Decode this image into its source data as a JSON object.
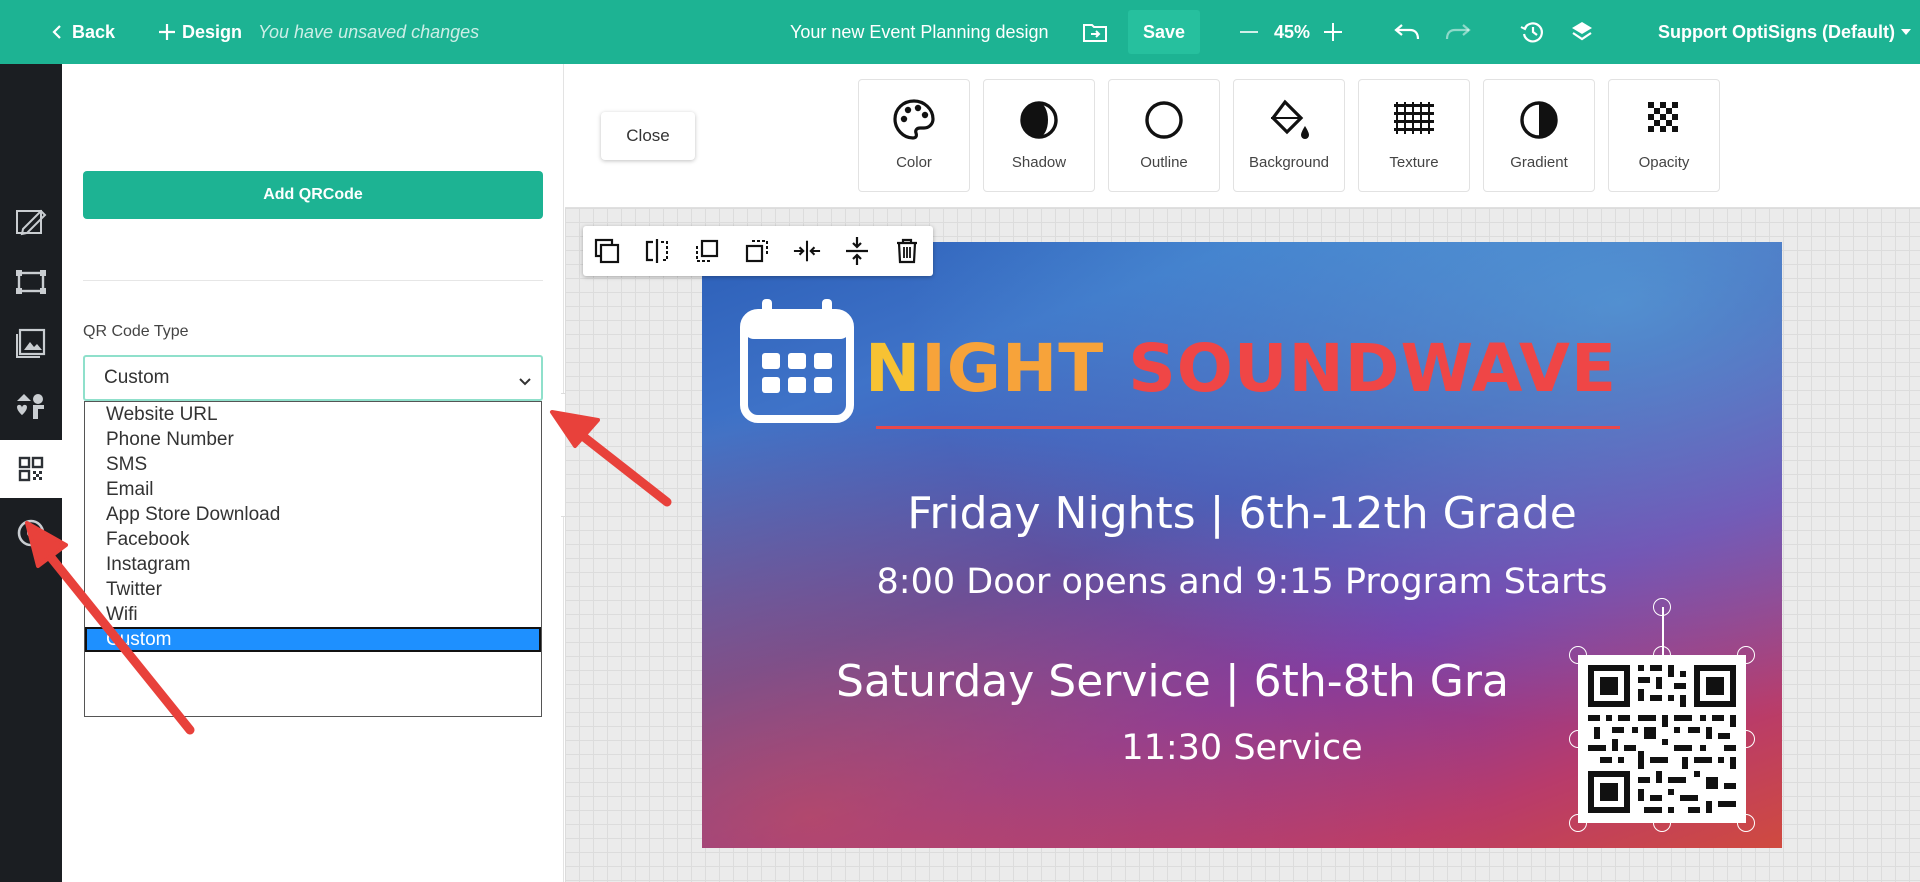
{
  "topbar": {
    "back_label": "Back",
    "design_label": "Design",
    "unsaved_text": "You have unsaved changes",
    "design_title": "Your new Event Planning design",
    "save_label": "Save",
    "zoom_level": "45%",
    "account_label": "Support OptiSigns (Default)"
  },
  "sidebar": {
    "icons": [
      "edit-icon",
      "layout-icon",
      "image-icon",
      "media-icon",
      "qr-code-icon",
      "apps-icon"
    ],
    "active": "qr-code-icon"
  },
  "panel": {
    "add_button_label": "Add QRCode",
    "qr_type_label": "QR Code Type",
    "selected_type": "Custom",
    "options": [
      "Website URL",
      "Phone Number",
      "SMS",
      "Email",
      "App Store Download",
      "Facebook",
      "Instagram",
      "Twitter",
      "Wifi",
      "Custom"
    ]
  },
  "properties": {
    "close_label": "Close",
    "tools": [
      "Color",
      "Shadow",
      "Outline",
      "Background",
      "Texture",
      "Gradient",
      "Opacity"
    ]
  },
  "poster": {
    "title_first": "N",
    "title_mid": "IGHT",
    "title_rest": " SOUNDWAVE",
    "line1": "Friday Nights | 6th-12th Grade",
    "line2": "8:00 Door opens and 9:15 Program Starts",
    "line3": "Saturday Service | 6th-8th Gra",
    "line4": "11:30 Service"
  },
  "colors": {
    "brand": "#1db393",
    "rail": "#1b1e22",
    "selected_option": "#1e90ff",
    "arrow": "#e8413b"
  }
}
